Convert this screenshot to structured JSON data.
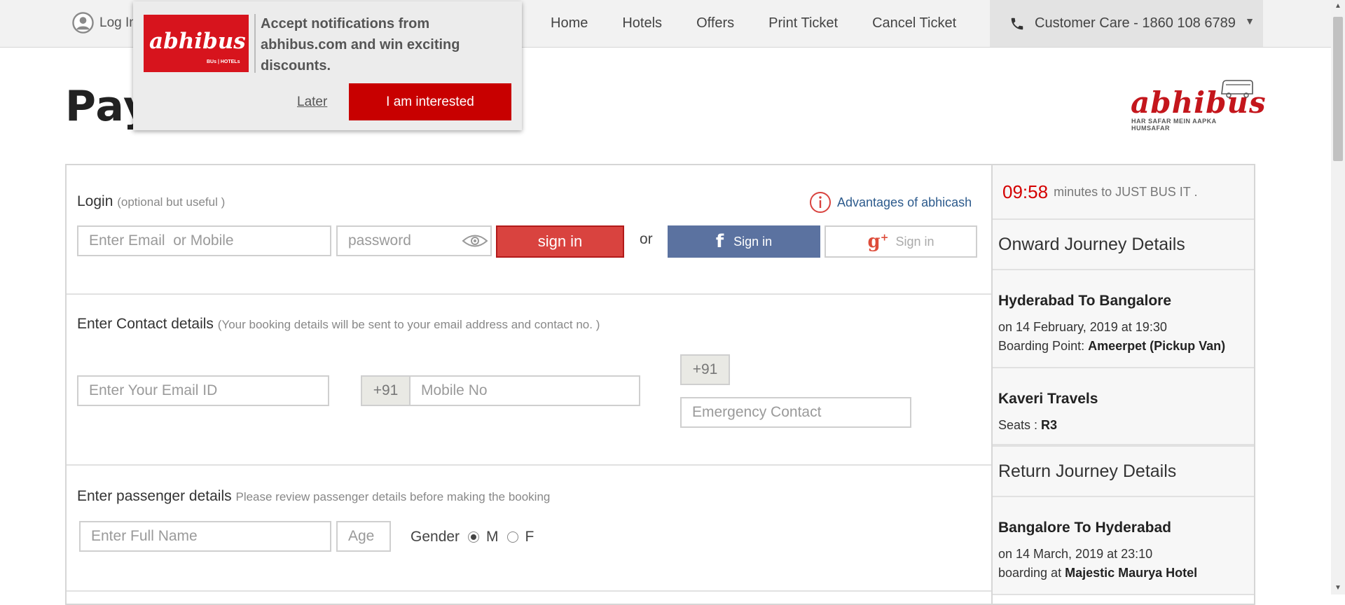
{
  "nav": {
    "login_label": "Log In",
    "links": [
      "Home",
      "Hotels",
      "Offers",
      "Print Ticket",
      "Cancel Ticket"
    ],
    "customer_care": "Customer Care - 1860 108 6789",
    "dropdown_arrow": "▼"
  },
  "page": {
    "title": "Payment"
  },
  "brand": {
    "logo_text": "abhibus",
    "tagline": "HAR SAFAR MEIN AAPKA HUMSAFAR"
  },
  "login": {
    "title": "Login",
    "note": "(optional but useful )",
    "advantages": "Advantages of abhicash",
    "email_placeholder": "Enter Email  or Mobile",
    "password_placeholder": "password",
    "signin_label": "sign in",
    "or": "or",
    "facebook_label": "Sign in",
    "google_label": "Sign in"
  },
  "contact": {
    "title": "Enter Contact details",
    "note": "(Your booking details will be sent to your email address and contact no. )",
    "email_placeholder": "Enter Your Email ID",
    "country_code": "+91",
    "mobile_placeholder": "Mobile No",
    "emergency_code": "+91",
    "emergency_placeholder": "Emergency Contact"
  },
  "passenger": {
    "title": "Enter passenger details",
    "note": "Please review passenger details before making the booking",
    "name_placeholder": "Enter Full Name",
    "age_placeholder": "Age",
    "gender_label": "Gender",
    "male": "M",
    "female": "F",
    "selected_gender": "M"
  },
  "sidebar": {
    "timer_value": "09:58",
    "timer_text": "minutes to JUST BUS IT .",
    "onward_title": "Onward Journey Details",
    "onward_route": "Hyderabad To Bangalore",
    "onward_date": "on 14 February, 2019 at 19:30",
    "onward_boarding_label": "Boarding Point:",
    "onward_boarding": "Ameerpet (Pickup Van)",
    "operator": "Kaveri Travels",
    "seats_label": "Seats :",
    "seats": "R3",
    "return_title": "Return Journey Details",
    "return_route": "Bangalore To Hyderabad",
    "return_date": "on 14 March, 2019 at 23:10",
    "return_boarding_label": "boarding at",
    "return_boarding": "Majestic Maurya Hotel"
  },
  "popup": {
    "logo_text": "abhibus",
    "logo_tag": "BUs | HOTELs",
    "message": "Accept notifications from abhibus.com and win exciting discounts.",
    "later": "Later",
    "accept": "I am interested"
  },
  "colors": {
    "brand_red": "#c80000",
    "signin_red": "#d9433f",
    "facebook_blue": "#5b72a0",
    "timer_red": "#d40000",
    "link_blue": "#2c5a8c"
  }
}
